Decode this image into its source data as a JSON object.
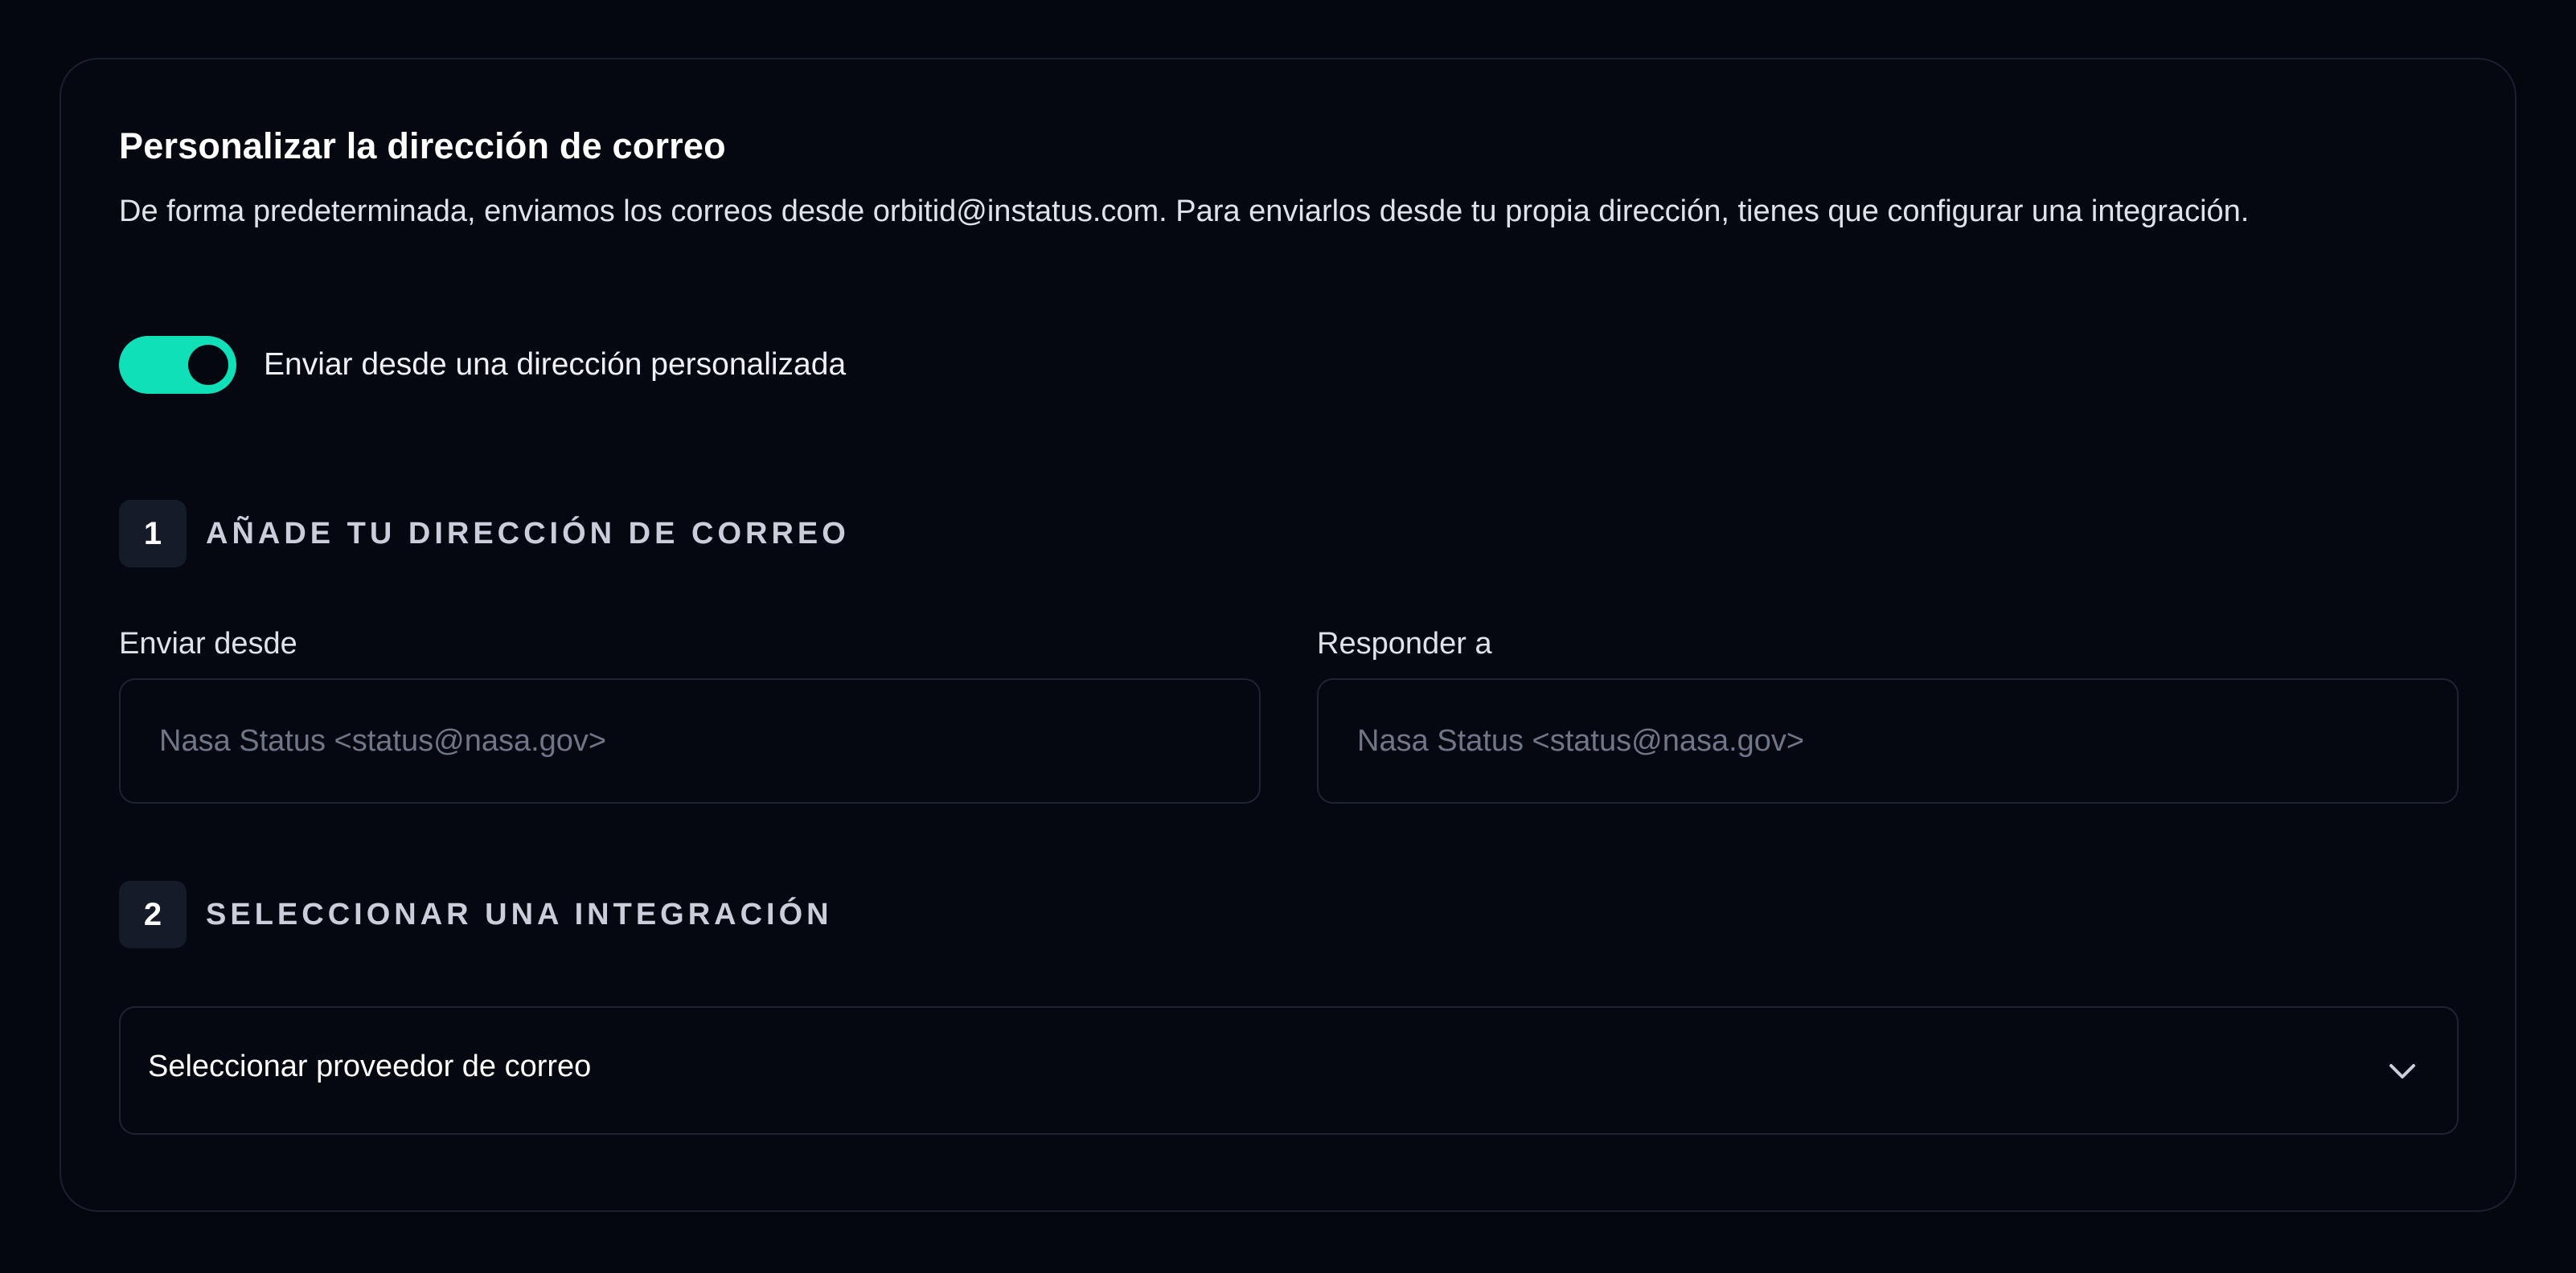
{
  "card": {
    "title": "Personalizar la dirección de correo",
    "description": "De forma predeterminada, enviamos los correos desde orbitid@instatus.com. Para enviarlos desde tu propia dirección, tienes que configurar una integración.",
    "toggle": {
      "label": "Enviar desde una dirección personalizada",
      "on": true,
      "accent_color": "#0fe0b8"
    }
  },
  "step1": {
    "number": "1",
    "title": "AÑADE TU DIRECCIÓN DE CORREO",
    "from_field": {
      "label": "Enviar desde",
      "value": "",
      "placeholder": "Nasa Status <status@nasa.gov>"
    },
    "reply_field": {
      "label": "Responder a",
      "value": "",
      "placeholder": "Nasa Status <status@nasa.gov>"
    }
  },
  "step2": {
    "number": "2",
    "title": "SELECCIONAR UNA INTEGRACIÓN",
    "select": {
      "selected": "Seleccionar proveedor de correo",
      "icon": "chevron-down-icon"
    }
  }
}
